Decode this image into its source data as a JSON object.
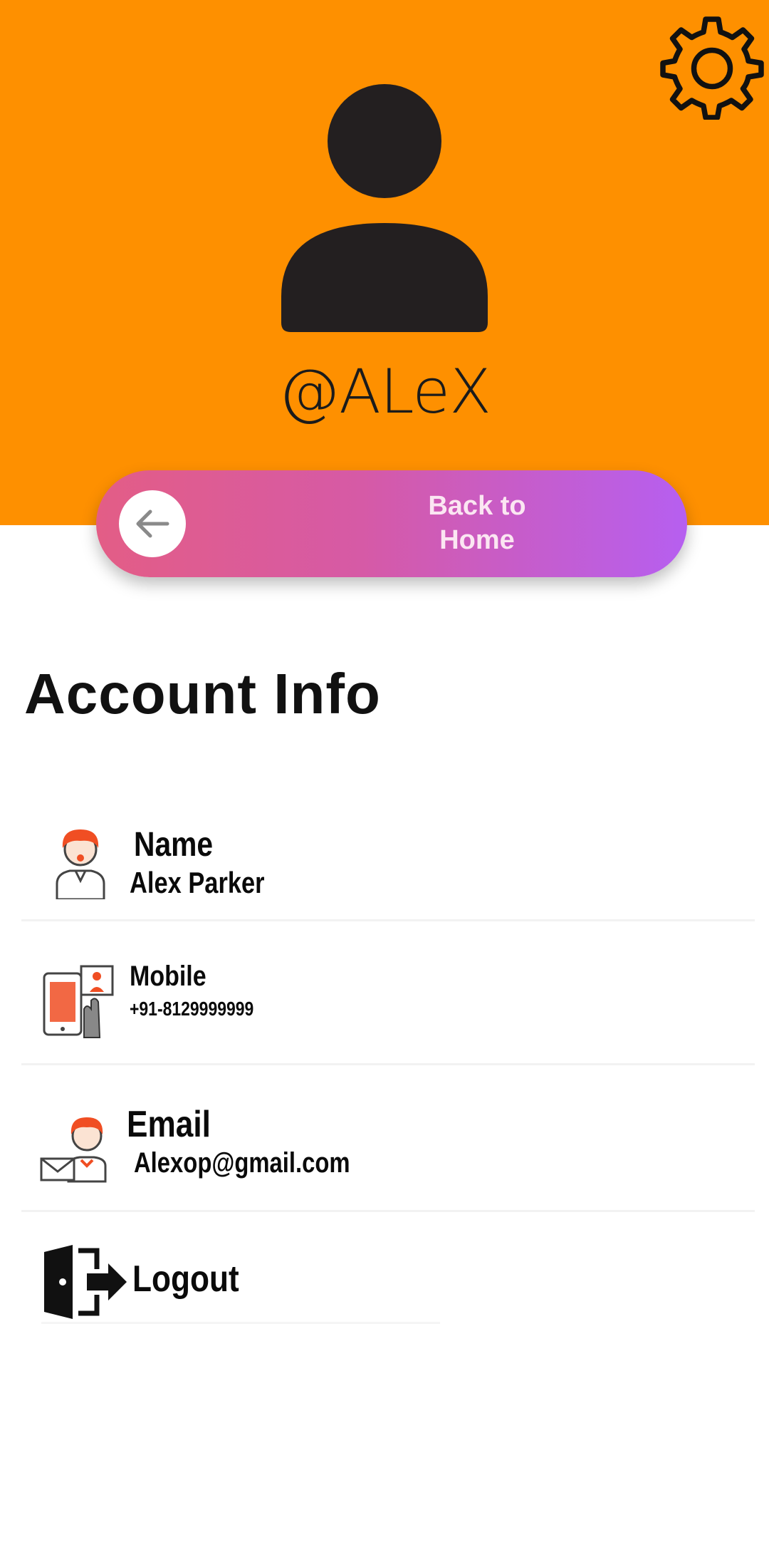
{
  "header": {
    "background_color": "#fe9000",
    "settings_icon": "gear-icon",
    "avatar_icon": "user-silhouette-icon",
    "username": "@ALeX"
  },
  "back_button": {
    "label": "Back to\nHome",
    "icon": "arrow-left-icon",
    "gradient_start": "#e35d86",
    "gradient_end": "#b65ff0"
  },
  "account_info": {
    "title": "Account Info",
    "items": [
      {
        "icon": "user-avatar-icon",
        "label": "Name",
        "value": "Alex Parker"
      },
      {
        "icon": "mobile-contact-icon",
        "label": "Mobile",
        "value": "+91-8129999999"
      },
      {
        "icon": "email-user-icon",
        "label": "Email",
        "value": "Alexop@gmail.com"
      }
    ]
  },
  "logout": {
    "icon": "logout-door-icon",
    "label": "Logout"
  }
}
